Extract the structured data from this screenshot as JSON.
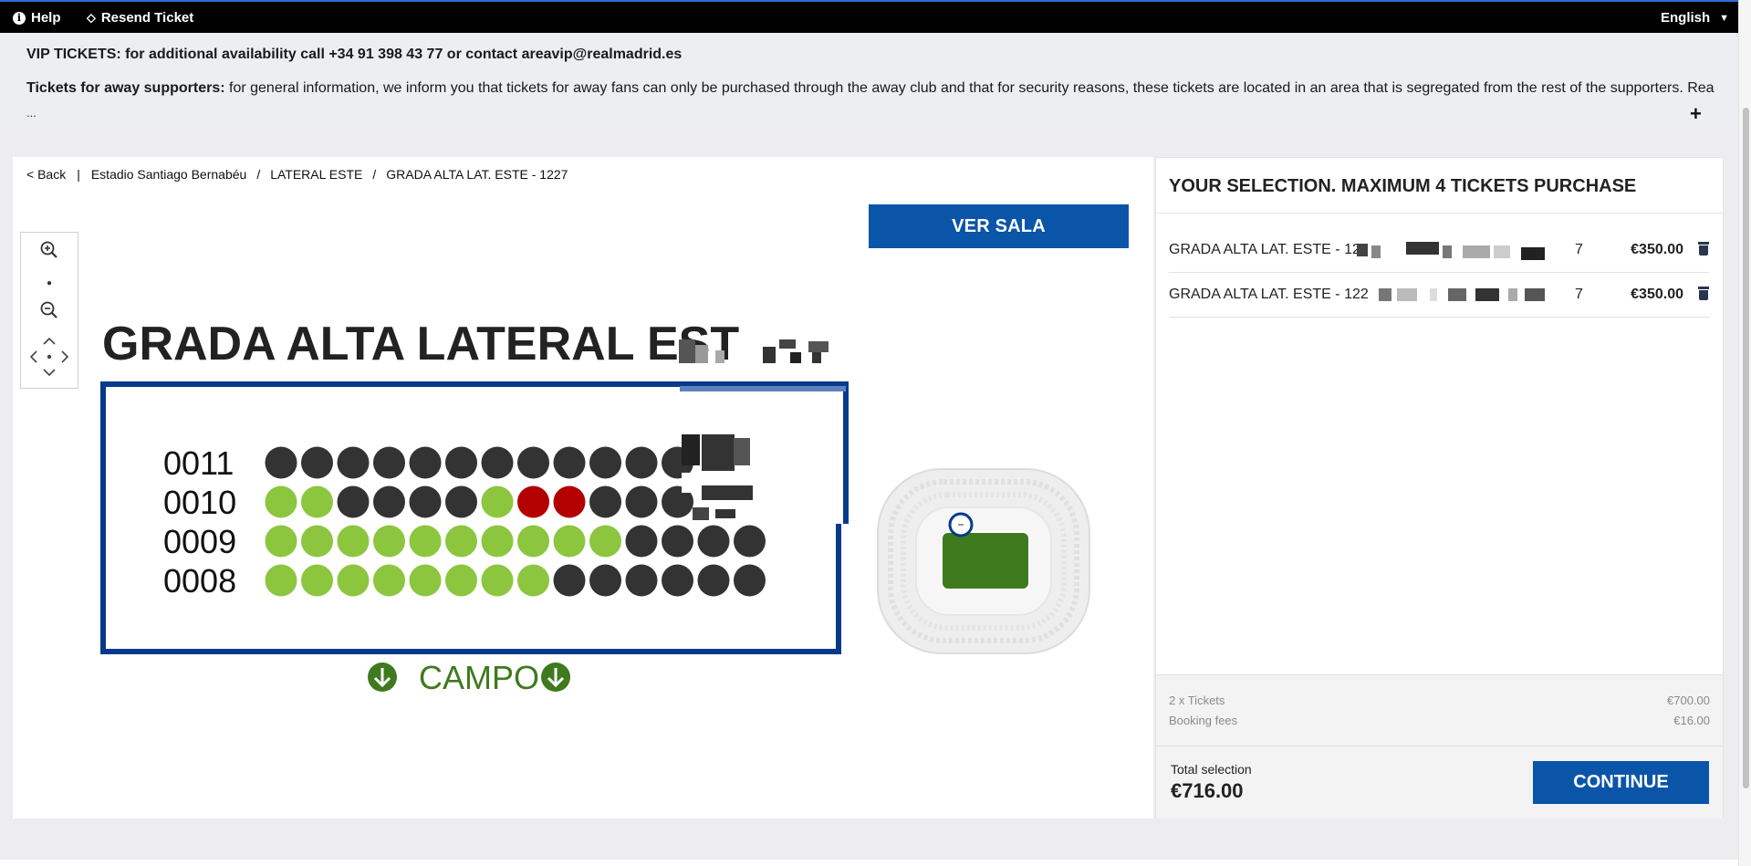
{
  "topbar": {
    "help_label": "Help",
    "resend_label": "Resend Ticket",
    "language": "English"
  },
  "notice": {
    "vip": "VIP TICKETS: for additional availability call +34 91 398 43 77 or contact areavip@realmadrid.es",
    "away_title": "Tickets for away supporters:",
    "away_text": " for general information, we inform you that tickets for away fans can only be purchased through the away club and that for security reasons, these tickets are located in an area that is segregated from the rest of the supporters. Real",
    "ellipsis": "...",
    "expand": "+"
  },
  "breadcrumb": {
    "back": "< Back",
    "divider": "|",
    "items": [
      "Estadio Santiago Bernabéu",
      "LATERAL ESTE",
      "GRADA ALTA LAT. ESTE - 1227"
    ],
    "sep": "/"
  },
  "ver_sala": "VER SALA",
  "seatmap": {
    "title": "GRADA ALTA LATERAL EST",
    "field_label": "CAMPO",
    "colors": {
      "available": "#8cc63f",
      "occupied": "#333333",
      "selected": "#b30000",
      "border": "#063a8c",
      "field": "#3f7a1f"
    },
    "rows": [
      {
        "label": "0011",
        "seats": [
          "o",
          "o",
          "o",
          "o",
          "o",
          "o",
          "o",
          "o",
          "o",
          "o",
          "o",
          "o"
        ]
      },
      {
        "label": "0010",
        "seats": [
          "a",
          "a",
          "o",
          "o",
          "o",
          "o",
          "a",
          "s",
          "s",
          "o",
          "o",
          "o"
        ]
      },
      {
        "label": "0009",
        "seats": [
          "a",
          "a",
          "a",
          "a",
          "a",
          "a",
          "a",
          "a",
          "a",
          "a",
          "o",
          "o",
          "o",
          "o"
        ]
      },
      {
        "label": "0008",
        "seats": [
          "a",
          "a",
          "a",
          "a",
          "a",
          "a",
          "a",
          "a",
          "o",
          "o",
          "o",
          "o",
          "o",
          "o"
        ]
      }
    ],
    "icons": [
      "zoom-in-icon",
      "zoom-out-icon",
      "pan-arrows-icon",
      "down-arrow-icon"
    ]
  },
  "selection": {
    "title": "YOUR SELECTION. MAXIMUM 4 TICKETS PURCHASE",
    "tickets": [
      {
        "name": "GRADA ALTA LAT. ESTE - 122",
        "tail": "7",
        "price": "€350.00"
      },
      {
        "name": "GRADA ALTA LAT. ESTE - 122",
        "tail": "7",
        "price": "€350.00"
      }
    ],
    "qty_label": "2 x Tickets",
    "qty_value": "€700.00",
    "fees_label": "Booking fees",
    "fees_value": "€16.00",
    "total_label": "Total selection",
    "total_value": "€716.00",
    "continue_label": "CONTINUE"
  }
}
